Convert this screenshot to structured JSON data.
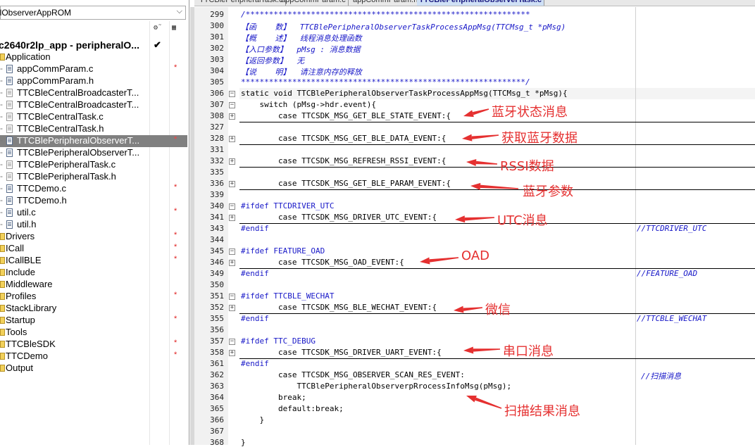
{
  "workspace": {
    "config_combo": "alObserverAppROM",
    "col1_icon": "tools-icon",
    "col2_icon": "build-icon",
    "project": "c2640r2lp_app - peripheralO...",
    "project_check": "✔",
    "tree": [
      {
        "label": "Application",
        "type": "folder",
        "mark": "",
        "dash": ""
      },
      {
        "label": "appCommParam.c",
        "type": "file",
        "mark": "*",
        "dash": "-"
      },
      {
        "label": "appCommParam.h",
        "type": "file",
        "mark": "",
        "dash": "-"
      },
      {
        "label": "TTCBleCentralBroadcasterT...",
        "type": "file-excluded",
        "mark": "",
        "dash": "-"
      },
      {
        "label": "TTCBleCentralBroadcasterT...",
        "type": "file-excluded",
        "mark": "",
        "dash": "-"
      },
      {
        "label": "TTCBleCentralTask.c",
        "type": "file-excluded",
        "mark": "",
        "dash": "-"
      },
      {
        "label": "TTCBleCentralTask.h",
        "type": "file-excluded",
        "mark": "",
        "dash": "-"
      },
      {
        "label": "TTCBlePeripheralObserverT...",
        "type": "file",
        "mark": "*",
        "dash": "-",
        "selected": true
      },
      {
        "label": "TTCBlePeripheralObserverT...",
        "type": "file",
        "mark": "",
        "dash": "-"
      },
      {
        "label": "TTCBlePeripheralTask.c",
        "type": "file-excluded",
        "mark": "",
        "dash": "-"
      },
      {
        "label": "TTCBlePeripheralTask.h",
        "type": "file-excluded",
        "mark": "",
        "dash": "-"
      },
      {
        "label": "TTCDemo.c",
        "type": "file",
        "mark": "*",
        "dash": "-"
      },
      {
        "label": "TTCDemo.h",
        "type": "file",
        "mark": "",
        "dash": "-"
      },
      {
        "label": "util.c",
        "type": "file",
        "mark": "*",
        "dash": "-"
      },
      {
        "label": "util.h",
        "type": "file",
        "mark": "",
        "dash": "-"
      },
      {
        "label": "Drivers",
        "type": "folder",
        "mark": "*",
        "dash": ""
      },
      {
        "label": "ICall",
        "type": "folder",
        "mark": "*",
        "dash": ""
      },
      {
        "label": "ICallBLE",
        "type": "folder",
        "mark": "*",
        "dash": ""
      },
      {
        "label": "Include",
        "type": "folder",
        "mark": "",
        "dash": ""
      },
      {
        "label": "Middleware",
        "type": "folder",
        "mark": "",
        "dash": ""
      },
      {
        "label": "Profiles",
        "type": "folder",
        "mark": "*",
        "dash": ""
      },
      {
        "label": "StackLibrary",
        "type": "folder",
        "mark": "",
        "dash": ""
      },
      {
        "label": "Startup",
        "type": "folder",
        "mark": "*",
        "dash": ""
      },
      {
        "label": "Tools",
        "type": "folder",
        "mark": "",
        "dash": ""
      },
      {
        "label": "TTCBleSDK",
        "type": "folder",
        "mark": "*",
        "dash": ""
      },
      {
        "label": "TTCDemo",
        "type": "folder",
        "mark": "*",
        "dash": ""
      },
      {
        "label": "Output",
        "type": "folder",
        "mark": "",
        "dash": ""
      }
    ]
  },
  "tabs": [
    {
      "label": "TTCBlePeripheralTask.c",
      "active": false
    },
    {
      "label": "appCommParam.c",
      "active": false
    },
    {
      "label": "appCommParam.h",
      "active": false
    },
    {
      "label": "TTCBlePeripheralObserverTask.c",
      "active": true
    },
    {
      "label": "TTCBlePeripheralObserverTask.h",
      "active": false,
      "right": true
    }
  ],
  "code_lines": [
    {
      "n": "299",
      "t": "/*************************************************************",
      "k": "cm"
    },
    {
      "n": "300",
      "t": "【函    数】  TTCBlePeripheralObserverTaskProcessAppMsg(TTCMsg_t *pMsg)",
      "k": "cm"
    },
    {
      "n": "301",
      "t": "【概    述】  线程消息处理函数",
      "k": "cm"
    },
    {
      "n": "302",
      "t": "【入口参数】  pMsg : 消息数据",
      "k": "cm"
    },
    {
      "n": "303",
      "t": "【返回参数】  无",
      "k": "cm"
    },
    {
      "n": "304",
      "t": "【说    明】  请注意内存的释放",
      "k": "cm"
    },
    {
      "n": "305",
      "t": "*************************************************************/",
      "k": "cm"
    },
    {
      "n": "306",
      "t": "static void TTCBlePeripheralObserverTaskProcessAppMsg(TTCMsg_t *pMsg){",
      "k": "",
      "fold": "-"
    },
    {
      "n": "307",
      "t": "    switch (pMsg->hdr.event){",
      "k": "",
      "fold": "-"
    },
    {
      "n": "308",
      "t": "        case TTCSDK_MSG_GET_BLE_STATE_EVENT:{",
      "k": "",
      "fold": "+",
      "ul": true
    },
    {
      "n": "327",
      "t": "",
      "k": ""
    },
    {
      "n": "328",
      "t": "        case TTCSDK_MSG_GET_BLE_DATA_EVENT:{",
      "k": "",
      "fold": "+",
      "ul": true
    },
    {
      "n": "331",
      "t": "",
      "k": ""
    },
    {
      "n": "332",
      "t": "        case TTCSDK_MSG_REFRESH_RSSI_EVENT:{",
      "k": "",
      "fold": "+",
      "ul": true
    },
    {
      "n": "335",
      "t": "",
      "k": ""
    },
    {
      "n": "336",
      "t": "        case TTCSDK_MSG_GET_BLE_PARAM_EVENT:{",
      "k": "",
      "fold": "+",
      "ul": true
    },
    {
      "n": "339",
      "t": "",
      "k": ""
    },
    {
      "n": "340",
      "t": "#ifdef TTCDRIVER_UTC",
      "k": "pp",
      "fold": "-"
    },
    {
      "n": "341",
      "t": "        case TTCSDK_MSG_DRIVER_UTC_EVENT:{",
      "k": "",
      "fold": "+",
      "ul": true
    },
    {
      "n": "343",
      "t": "#endif",
      "k": "pp",
      "trail": "//TTCDRIVER_UTC"
    },
    {
      "n": "344",
      "t": "",
      "k": ""
    },
    {
      "n": "345",
      "t": "#ifdef FEATURE_OAD",
      "k": "pp",
      "fold": "-"
    },
    {
      "n": "346",
      "t": "        case TTCSDK_MSG_OAD_EVENT:{",
      "k": "",
      "fold": "+",
      "ul": true
    },
    {
      "n": "349",
      "t": "#endif",
      "k": "pp",
      "trail": "//FEATURE_OAD"
    },
    {
      "n": "350",
      "t": "",
      "k": ""
    },
    {
      "n": "351",
      "t": "#ifdef TTCBLE_WECHAT",
      "k": "pp",
      "fold": "-"
    },
    {
      "n": "352",
      "t": "        case TTCSDK_MSG_BLE_WECHAT_EVENT:{",
      "k": "",
      "fold": "+",
      "ul": true
    },
    {
      "n": "355",
      "t": "#endif",
      "k": "pp",
      "trail": "//TTCBLE_WECHAT"
    },
    {
      "n": "356",
      "t": "",
      "k": ""
    },
    {
      "n": "357",
      "t": "#ifdef TTC_DEBUG",
      "k": "pp",
      "fold": "-"
    },
    {
      "n": "358",
      "t": "        case TTCSDK_MSG_DRIVER_UART_EVENT:{",
      "k": "",
      "fold": "+",
      "ul": true
    },
    {
      "n": "361",
      "t": "#endif",
      "k": "pp"
    },
    {
      "n": "362",
      "t": "        case TTCSDK_MSG_OBSERVER_SCAN_RES_EVENT:",
      "k": "",
      "trail": "//扫描消息"
    },
    {
      "n": "363",
      "t": "            TTCBlePeripheralObserverpRrocessInfoMsg(pMsg);",
      "k": ""
    },
    {
      "n": "364",
      "t": "        break;",
      "k": ""
    },
    {
      "n": "365",
      "t": "        default:break;",
      "k": ""
    },
    {
      "n": "366",
      "t": "    }",
      "k": ""
    },
    {
      "n": "367",
      "t": "",
      "k": ""
    },
    {
      "n": "368",
      "t": "}",
      "k": ""
    }
  ],
  "annotations": [
    {
      "text": "蓝牙状态消息"
    },
    {
      "text": "获取蓝牙数据"
    },
    {
      "text": "RSSI数据"
    },
    {
      "text": "蓝牙参数"
    },
    {
      "text": "UTC消息"
    },
    {
      "text": "OAD"
    },
    {
      "text": "微信"
    },
    {
      "text": "串口消息"
    },
    {
      "text": "扫描结果消息"
    }
  ],
  "colors": {
    "annotation": "#e53030",
    "comment": "#1818c8",
    "selection": "#808080"
  }
}
